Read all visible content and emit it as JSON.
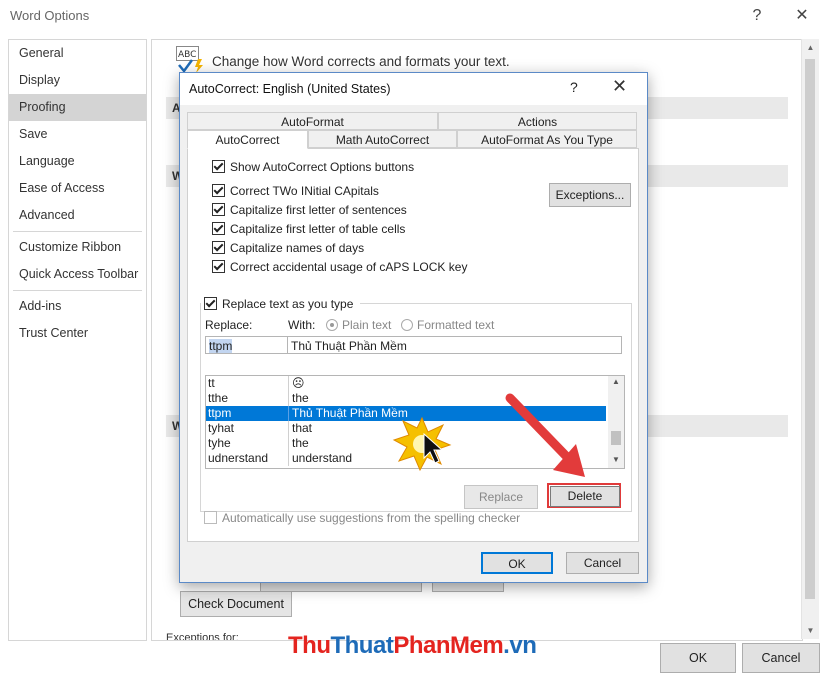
{
  "window": {
    "title": "Word Options",
    "help_glyph": "?",
    "close_glyph": "✕"
  },
  "nav": {
    "items": [
      "General",
      "Display",
      "Proofing",
      "Save",
      "Language",
      "Ease of Access",
      "Advanced",
      "Customize Ribbon",
      "Quick Access Toolbar",
      "Add-ins",
      "Trust Center"
    ],
    "selected": "Proofing"
  },
  "main": {
    "heading": "Change how Word corrects and formats your text.",
    "abc_label": "ABC",
    "section_letters": [
      "A",
      "W",
      "W"
    ],
    "check_document_label": "Check Document",
    "exceptions_for_label": "Exceptions for:"
  },
  "outer_buttons": {
    "ok": "OK",
    "cancel": "Cancel"
  },
  "dialog": {
    "title": "AutoCorrect: English (United States)",
    "help_glyph": "?",
    "close_glyph": "✕",
    "tabs_row1": [
      "AutoFormat",
      "Actions"
    ],
    "tabs_row2": [
      "AutoCorrect",
      "Math AutoCorrect",
      "AutoFormat As You Type"
    ],
    "active_tab": "AutoCorrect",
    "options": [
      {
        "label": "Show AutoCorrect Options buttons",
        "checked": true
      },
      {
        "label": "Correct TWo INitial CApitals",
        "checked": true
      },
      {
        "label": "Capitalize first letter of sentences",
        "checked": true
      },
      {
        "label": "Capitalize first letter of table cells",
        "checked": true
      },
      {
        "label": "Capitalize names of days",
        "checked": true
      },
      {
        "label": "Correct accidental usage of cAPS LOCK key",
        "checked": true
      }
    ],
    "exceptions_button": "Exceptions...",
    "replace_as_you_type": {
      "label": "Replace text as you type",
      "checked": true
    },
    "replace_label": "Replace:",
    "with_label": "With:",
    "radio_plain": "Plain text",
    "radio_formatted": "Formatted text",
    "replace_value": "ttpm",
    "with_value": "Thủ Thuật Phần Mềm",
    "entries": [
      {
        "key": "tt",
        "value": "☹"
      },
      {
        "key": "tthe",
        "value": "the"
      },
      {
        "key": "ttpm",
        "value": "Thủ Thuật Phần Mềm"
      },
      {
        "key": "tyhat",
        "value": "that"
      },
      {
        "key": "tyhe",
        "value": "the"
      },
      {
        "key": "udnerstand",
        "value": "understand"
      }
    ],
    "selected_entry": "ttpm",
    "replace_button": "Replace",
    "delete_button": "Delete",
    "auto_suggestions": {
      "label": "Automatically use suggestions from the spelling checker",
      "checked": false
    },
    "ok_button": "OK",
    "cancel_button": "Cancel"
  },
  "watermark": {
    "part1": "Thu",
    "part2": "Thuat",
    "part3": "PhanMem",
    "part4": ".vn"
  },
  "colors": {
    "accent": "#0078d7",
    "highlight": "#e03a3a",
    "arrow": "#e23b3b",
    "burst": "#f5c000"
  }
}
